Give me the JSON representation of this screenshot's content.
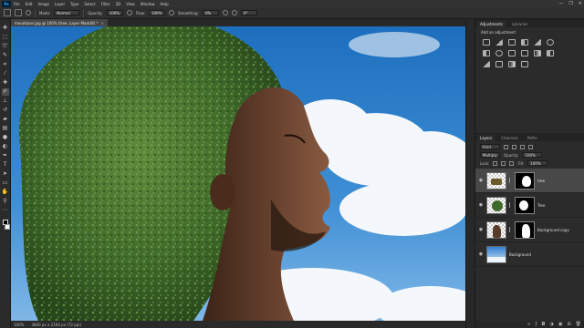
{
  "app": {
    "logo": "Ps"
  },
  "menu": [
    "File",
    "Edit",
    "Image",
    "Layer",
    "Type",
    "Select",
    "Filter",
    "3D",
    "View",
    "Window",
    "Help"
  ],
  "window_controls": [
    "—",
    "❐",
    "✕"
  ],
  "options": {
    "mode_label": "Mode:",
    "mode_value": "Normal",
    "opacity_label": "Opacity:",
    "opacity_value": "100%",
    "flow_label": "Flow:",
    "flow_value": "100%",
    "smoothing_label": "Smoothing:",
    "smoothing_value": "0%",
    "angle_value": "0°"
  },
  "document": {
    "tab_label": "mountains.jpg @ 100% (tree, Layer Mask/8) *",
    "close_glyph": "×"
  },
  "toolbar": {
    "tools": [
      "move-icon",
      "marquee-icon",
      "lasso-icon",
      "quick-select-icon",
      "crop-icon",
      "eyedropper-icon",
      "healing-icon",
      "brush-icon",
      "stamp-icon",
      "history-brush-icon",
      "eraser-icon",
      "gradient-icon",
      "blur-icon",
      "dodge-icon",
      "pen-icon",
      "type-icon",
      "path-select-icon",
      "shape-icon",
      "hand-icon",
      "zoom-icon"
    ],
    "active_index": 7
  },
  "status": {
    "zoom": "100%",
    "doc_info": "3840 px x 2160 px (72 ppi)"
  },
  "panels": {
    "adjust_tabs": [
      "Adjustments",
      "Libraries"
    ],
    "adjust_title": "Add an adjustment",
    "layer_tabs": [
      "Layers",
      "Channels",
      "Paths"
    ],
    "kind_label": "Kind",
    "blend_mode": "Multiply",
    "opacity_label": "Opacity:",
    "opacity_value": "100%",
    "lock_label": "Lock:",
    "fill_label": "Fill:",
    "fill_value": "100%"
  },
  "layers": [
    {
      "name": "tree",
      "selected": true
    },
    {
      "name": "Tree",
      "selected": false
    },
    {
      "name": "Background copy",
      "selected": false
    },
    {
      "name": "Background",
      "selected": false
    }
  ],
  "colors": {
    "accent": "#31a8ff",
    "panel_bg": "#2b2b2b",
    "sky": "#3f8fd6"
  }
}
